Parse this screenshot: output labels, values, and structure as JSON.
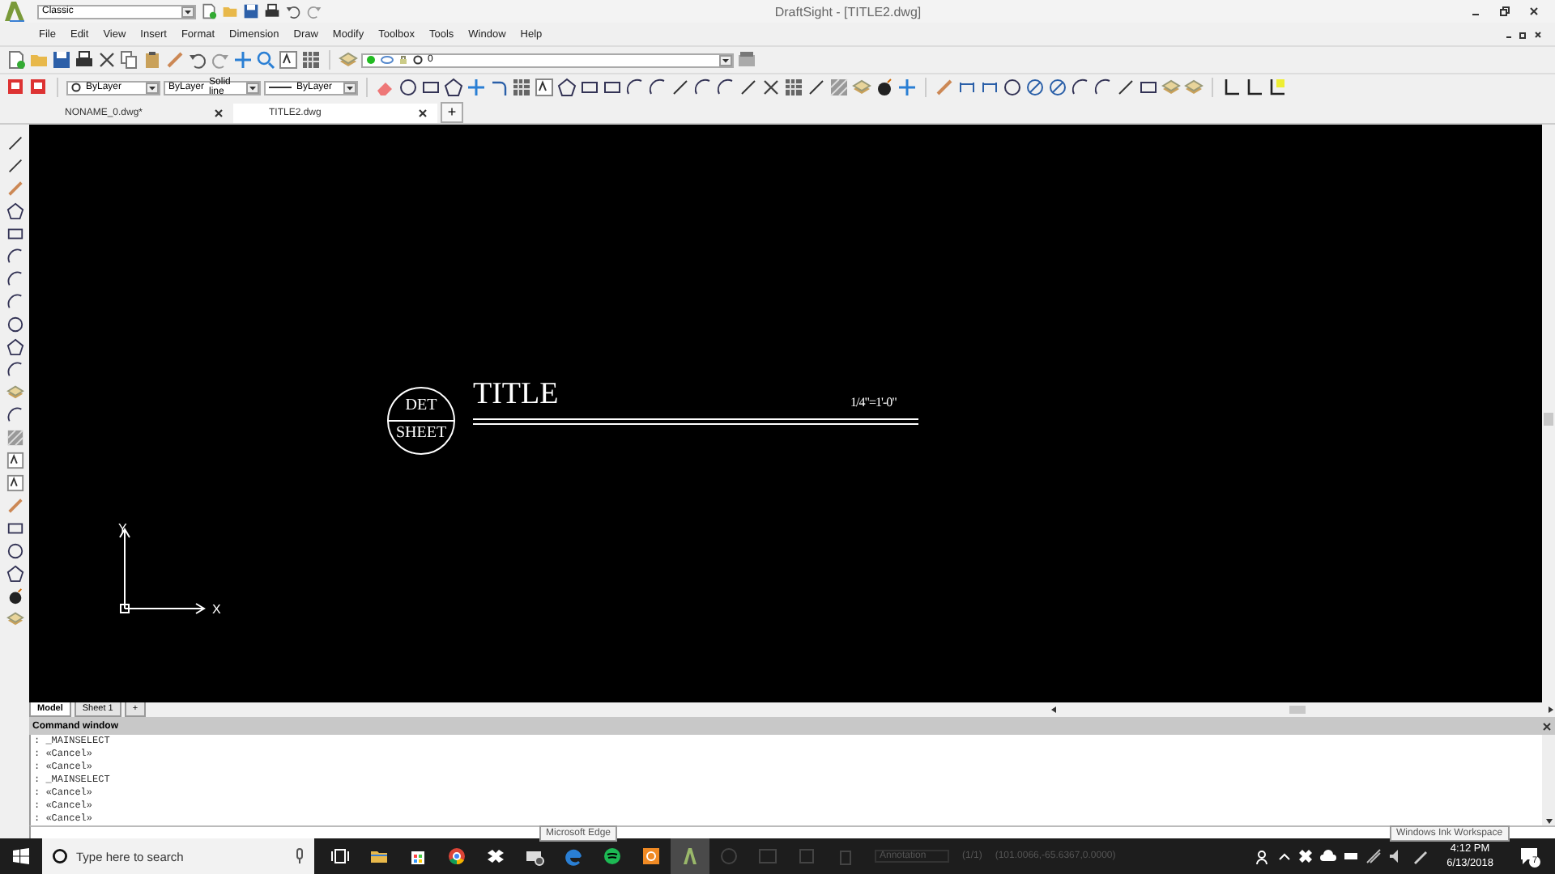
{
  "app": {
    "workspace": "Classic",
    "title": "DraftSight - [TITLE2.dwg]"
  },
  "menu": [
    "File",
    "Edit",
    "View",
    "Insert",
    "Format",
    "Dimension",
    "Draw",
    "Modify",
    "Toolbox",
    "Tools",
    "Window",
    "Help"
  ],
  "properties": {
    "entity_color": "ByLayer",
    "line_source": "ByLayer",
    "line_style": "Solid line",
    "line_weight": "ByLayer"
  },
  "layer": {
    "name": "0"
  },
  "doc_tabs": [
    {
      "label": "NONAME_0.dwg*",
      "selected": false
    },
    {
      "label": "TITLE2.dwg",
      "selected": true
    }
  ],
  "drawing": {
    "bubble_top": "DET",
    "bubble_bottom": "SHEET",
    "title": "TITLE",
    "scale": "1/4\"=1'-0\"",
    "axis_y": "Y",
    "axis_x": "X"
  },
  "layout_tabs": [
    {
      "label": "Model",
      "selected": true
    },
    {
      "label": "Sheet 1",
      "selected": false
    }
  ],
  "add_tab": "+",
  "command_window": {
    "title": "Command window",
    "lines": [
      ": _MAINSELECT",
      ": «Cancel»",
      ": «Cancel»",
      ": _MAINSELECT",
      ": «Cancel»",
      ": «Cancel»",
      ": «Cancel»"
    ]
  },
  "taskbar_tooltip": "Microsoft Edge",
  "tray_tooltip": "Windows Ink Workspace",
  "status": {
    "annotation": "Annotation",
    "page": "(1/1)",
    "coordinates": "(101.0066,-65.6367,0.0000)"
  },
  "taskbar": {
    "search_placeholder": "Type here to search",
    "time": "4:12 PM",
    "date": "6/13/2018",
    "notifications": "7"
  }
}
